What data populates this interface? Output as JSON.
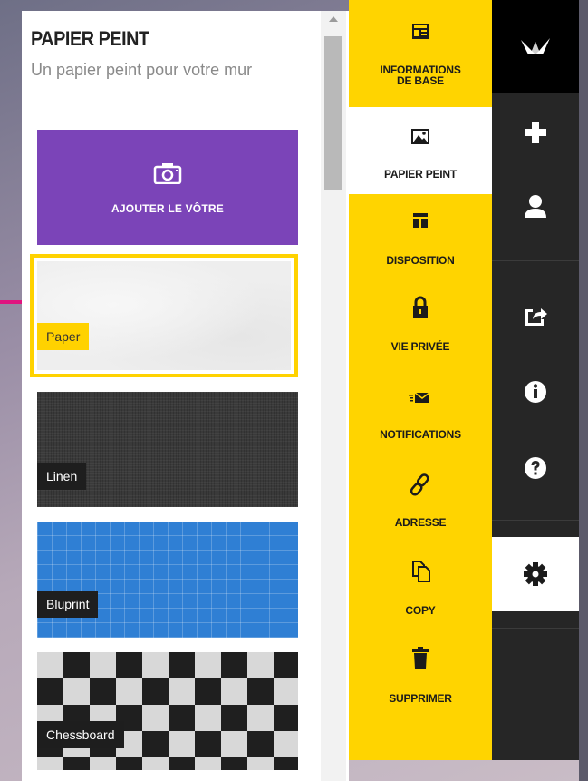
{
  "panel": {
    "title": "PAPIER PEINT",
    "subtitle": "Un papier peint pour votre mur",
    "upload_label": "AJOUTER LE VÔTRE",
    "wallpapers": [
      {
        "label": "Paper",
        "selected": true
      },
      {
        "label": "Linen",
        "selected": false
      },
      {
        "label": "Bluprint",
        "selected": false
      },
      {
        "label": "Chessboard",
        "selected": false
      }
    ]
  },
  "menu": {
    "items": [
      {
        "label_line1": "INFORMATIONS",
        "label_line2": "DE BASE",
        "icon": "info-card-icon"
      },
      {
        "label_line1": "PAPIER PEINT",
        "icon": "image-icon",
        "active": true
      },
      {
        "label_line1": "DISPOSITION",
        "icon": "layout-icon"
      },
      {
        "label_line1": "VIE PRIVÉE",
        "icon": "lock-icon"
      },
      {
        "label_line1": "NOTIFICATIONS",
        "icon": "envelope-icon"
      },
      {
        "label_line1": "ADRESSE",
        "icon": "link-icon"
      },
      {
        "label_line1": "COPY",
        "icon": "copy-icon"
      },
      {
        "label_line1": "SUPPRIMER",
        "icon": "trash-icon"
      }
    ]
  },
  "dock": {
    "icons": [
      "crane-logo-icon",
      "plus-icon",
      "user-icon",
      "share-icon",
      "info-icon",
      "help-icon",
      "gear-icon"
    ]
  },
  "colors": {
    "accent_yellow": "#ffd400",
    "upload_purple": "#7b44b8",
    "dock_dark": "#262626",
    "arrow_pink": "#e0147f",
    "blueprint_blue": "#2f7fd4"
  }
}
